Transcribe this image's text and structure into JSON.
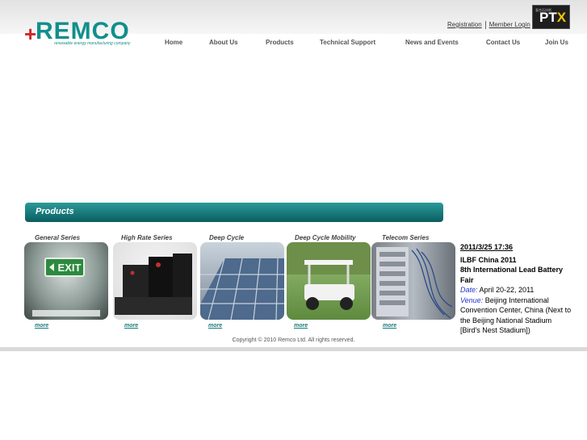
{
  "brand": {
    "cross": "+",
    "name": "REMCO",
    "tagline": "renewable energy manufacturing company"
  },
  "toplinks": {
    "registration": "Registration",
    "member_login": "Member Login"
  },
  "partner_logo": {
    "small_text": "泰克石技術",
    "text": "PT",
    "accent": "X"
  },
  "nav": [
    "Home",
    "About Us",
    "Products",
    "Technical Support",
    "News and Events",
    "Contact Us",
    "Join Us"
  ],
  "products": {
    "heading": "Products",
    "items": [
      {
        "series": "General Series",
        "more": "more"
      },
      {
        "series": "High Rate Series",
        "more": "more"
      },
      {
        "series": "Deep Cycle",
        "more": "more"
      },
      {
        "series": "Deep Cycle Mobility",
        "more": "more"
      },
      {
        "series": "Telecom Series",
        "more": "more"
      }
    ],
    "exit_sign": "EXIT"
  },
  "news": {
    "date": "2011/3/25 17:36",
    "title_line1": "ILBF China 2011",
    "title_line2": "8th International Lead Battery Fair",
    "date_label": "Date:",
    "date_value": "April 20-22, 2011",
    "venue_label": "Venue:",
    "venue_value": "Beijing International Convention Center, China (Next to the Beijing National Stadium [Bird's Nest Stadium])"
  },
  "footer": {
    "copyright": "Copyright © 2010 Remco Ltd. All rights reserved."
  },
  "colors": {
    "brand_teal": "#118f8c",
    "brand_red": "#d0262a",
    "bar_dark": "#0b5d5f",
    "link_blue": "#2233cc"
  }
}
